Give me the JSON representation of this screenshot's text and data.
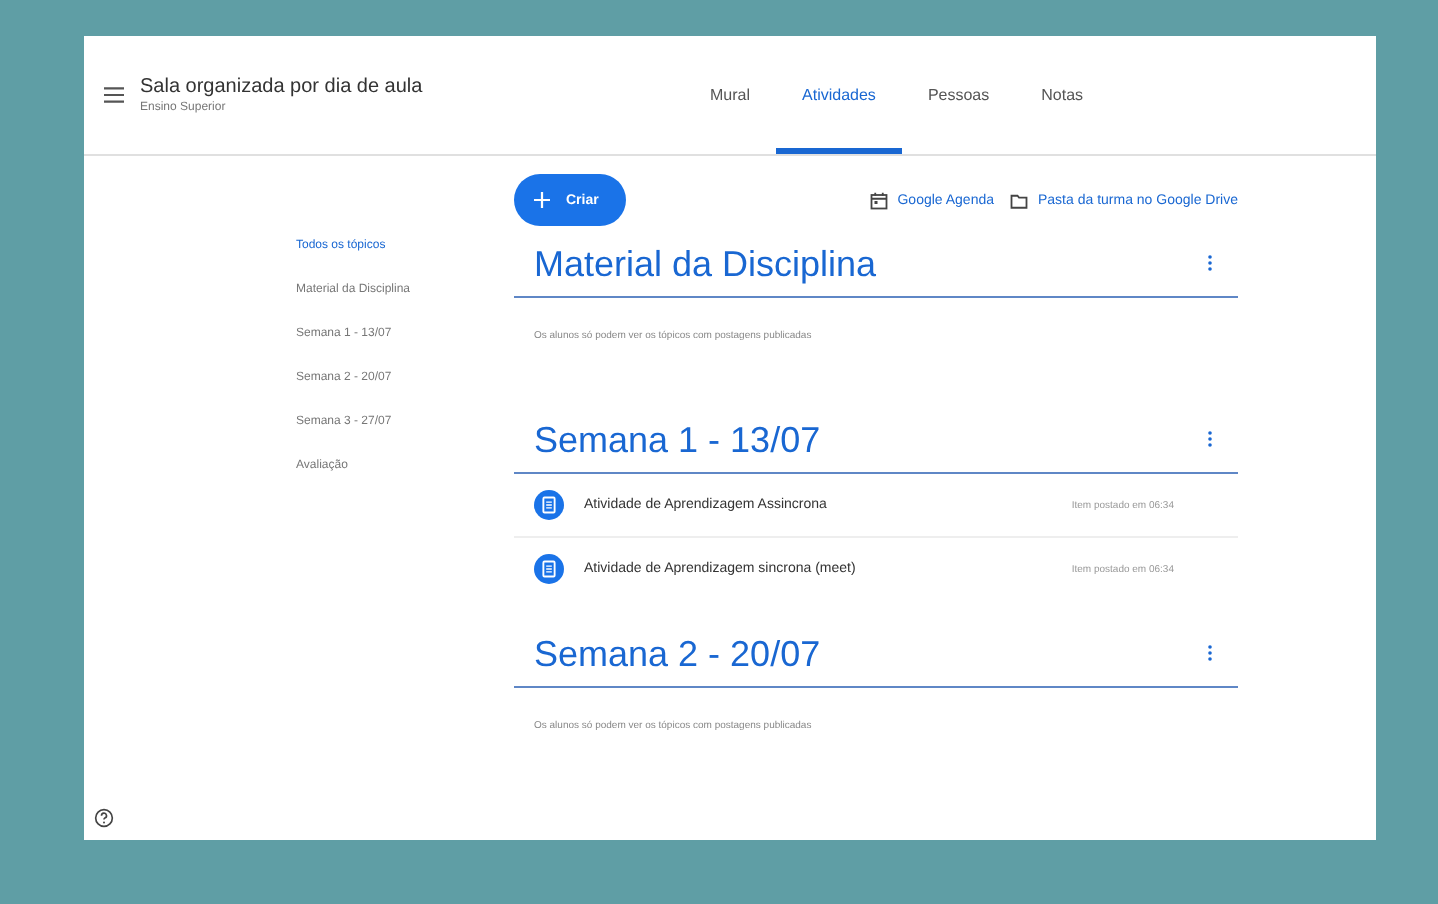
{
  "header": {
    "title": "Sala organizada por dia de aula",
    "subtitle": "Ensino Superior"
  },
  "tabs": [
    {
      "label": "Mural",
      "selected": false
    },
    {
      "label": "Atividades",
      "selected": true
    },
    {
      "label": "Pessoas",
      "selected": false
    },
    {
      "label": "Notas",
      "selected": false
    }
  ],
  "create_button": {
    "label": "Criar"
  },
  "links": [
    {
      "kind": "calendar",
      "label": "Google Agenda"
    },
    {
      "kind": "folder",
      "label": "Pasta da turma no Google Drive"
    }
  ],
  "topics": [
    {
      "label": "Todos os tópicos",
      "selected": true
    },
    {
      "label": "Material da Disciplina",
      "selected": false
    },
    {
      "label": "Semana 1 - 13/07",
      "selected": false
    },
    {
      "label": "Semana 2 - 20/07",
      "selected": false
    },
    {
      "label": "Semana 3 - 27/07",
      "selected": false
    },
    {
      "label": "Avaliação",
      "selected": false
    }
  ],
  "sections": [
    {
      "title": "Material da Disciplina",
      "note": "Os alunos só podem ver os tópicos com postagens publicadas"
    },
    {
      "title": "Semana 1 - 13/07",
      "items": [
        {
          "title": "Atividade de Aprendizagem Assincrona",
          "posted": "Item postado em 06:34"
        },
        {
          "title": "Atividade de Aprendizagem sincrona (meet)",
          "posted": "Item postado em 06:34"
        }
      ]
    },
    {
      "title": "Semana 2 - 20/07",
      "note": "Os alunos só podem ver os tópicos com postagens publicadas"
    }
  ]
}
